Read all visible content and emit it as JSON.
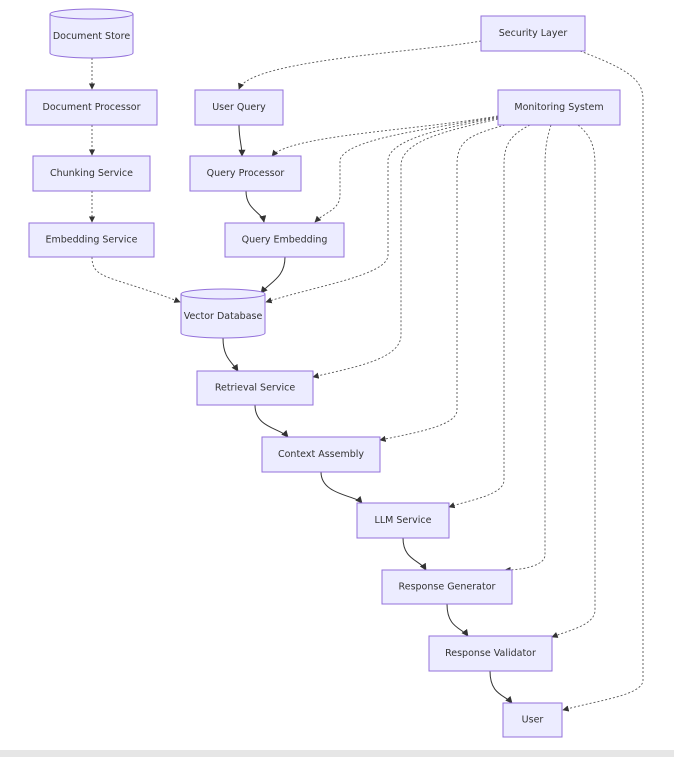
{
  "nodes": {
    "doc_store": "Document Store",
    "doc_processor": "Document Processor",
    "chunking": "Chunking Service",
    "embedding": "Embedding Service",
    "user_query": "User Query",
    "query_processor": "Query Processor",
    "query_embedding": "Query Embedding",
    "vector_db": "Vector Database",
    "retrieval": "Retrieval Service",
    "context": "Context Assembly",
    "llm": "LLM Service",
    "response_gen": "Response Generator",
    "response_val": "Response Validator",
    "user": "User",
    "security": "Security Layer",
    "monitoring": "Monitoring System"
  },
  "edges": [
    {
      "from": "doc_store",
      "to": "doc_processor",
      "style": "dotted"
    },
    {
      "from": "doc_processor",
      "to": "chunking",
      "style": "dotted"
    },
    {
      "from": "chunking",
      "to": "embedding",
      "style": "dotted"
    },
    {
      "from": "embedding",
      "to": "vector_db",
      "style": "dotted"
    },
    {
      "from": "user_query",
      "to": "query_processor",
      "style": "solid"
    },
    {
      "from": "query_processor",
      "to": "query_embedding",
      "style": "solid"
    },
    {
      "from": "query_embedding",
      "to": "vector_db",
      "style": "solid"
    },
    {
      "from": "vector_db",
      "to": "retrieval",
      "style": "solid"
    },
    {
      "from": "retrieval",
      "to": "context",
      "style": "solid"
    },
    {
      "from": "context",
      "to": "llm",
      "style": "solid"
    },
    {
      "from": "llm",
      "to": "response_gen",
      "style": "solid"
    },
    {
      "from": "response_gen",
      "to": "response_val",
      "style": "solid"
    },
    {
      "from": "response_val",
      "to": "user",
      "style": "solid"
    },
    {
      "from": "security",
      "to": "user_query",
      "style": "dotted"
    },
    {
      "from": "security",
      "to": "user",
      "style": "dotted"
    },
    {
      "from": "monitoring",
      "to": "query_processor",
      "style": "dotted"
    },
    {
      "from": "monitoring",
      "to": "query_embedding",
      "style": "dotted"
    },
    {
      "from": "monitoring",
      "to": "vector_db",
      "style": "dotted"
    },
    {
      "from": "monitoring",
      "to": "retrieval",
      "style": "dotted"
    },
    {
      "from": "monitoring",
      "to": "context",
      "style": "dotted"
    },
    {
      "from": "monitoring",
      "to": "llm",
      "style": "dotted"
    },
    {
      "from": "monitoring",
      "to": "response_gen",
      "style": "dotted"
    },
    {
      "from": "monitoring",
      "to": "response_val",
      "style": "dotted"
    }
  ],
  "colors": {
    "node_fill": "#ececff",
    "node_stroke": "#9370db",
    "edge": "#333333"
  }
}
